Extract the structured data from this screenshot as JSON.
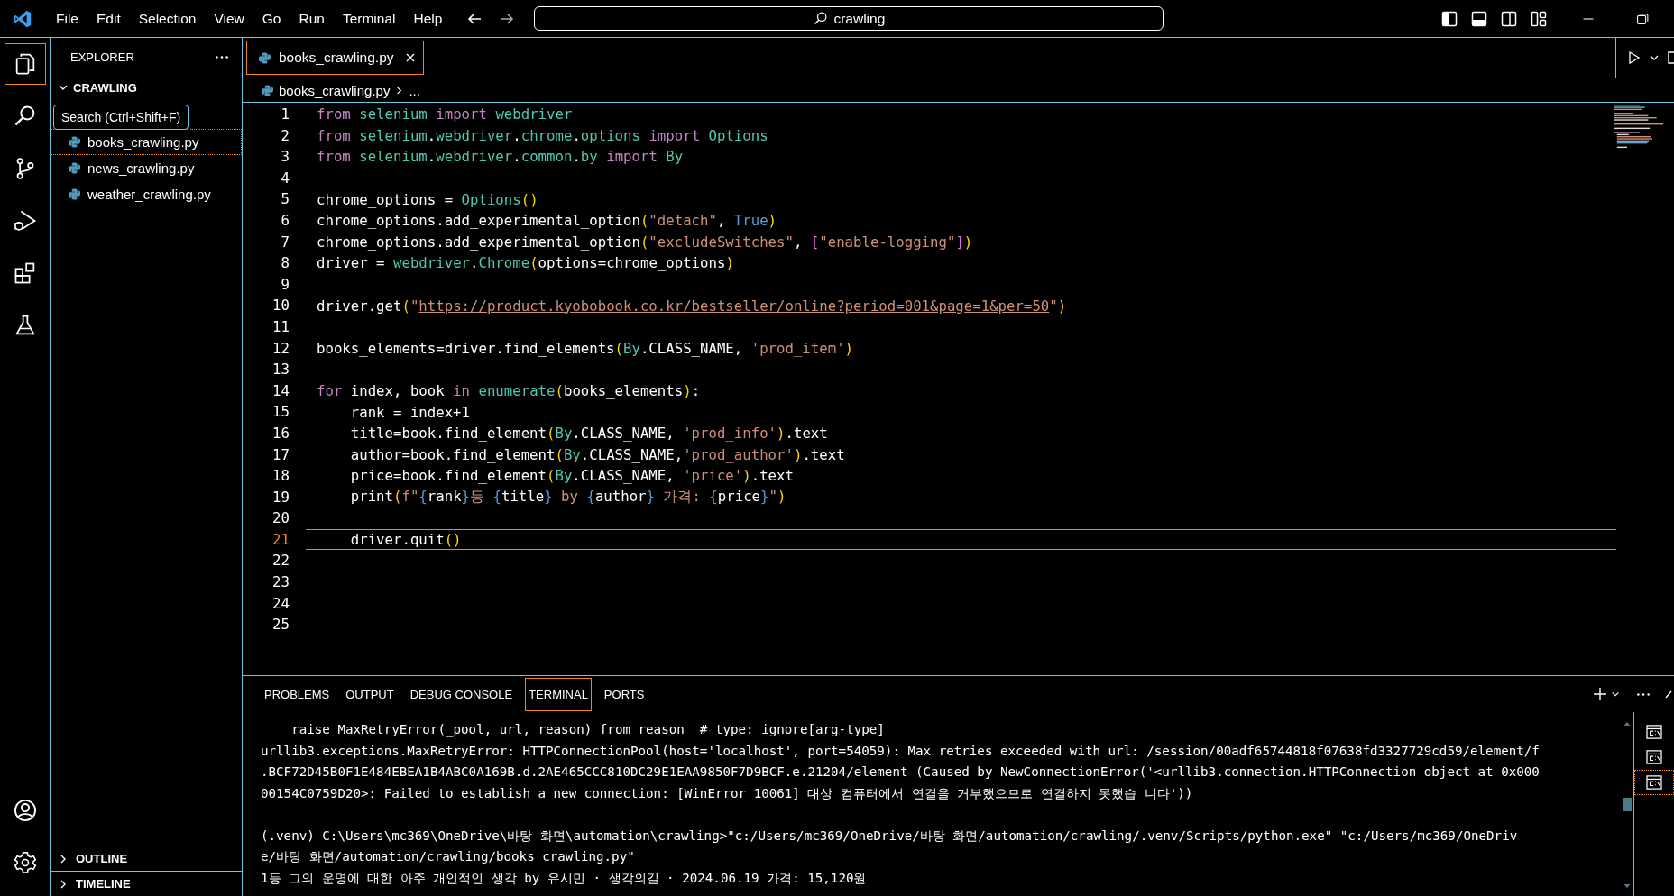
{
  "menu": [
    "File",
    "Edit",
    "Selection",
    "View",
    "Go",
    "Run",
    "Terminal",
    "Help"
  ],
  "command_center": {
    "value": "crawling"
  },
  "activity_bar": [
    {
      "kind": "files",
      "selected": true
    },
    {
      "kind": "search",
      "selected": false
    },
    {
      "kind": "source-control",
      "selected": false
    },
    {
      "kind": "run-debug",
      "selected": false
    },
    {
      "kind": "extensions",
      "selected": false
    },
    {
      "kind": "testing",
      "selected": false
    }
  ],
  "tooltip": "Search (Ctrl+Shift+F)",
  "sidebar": {
    "title": "EXPLORER",
    "folder": {
      "label": "CRAWLING",
      "expanded": true
    },
    "files": [
      {
        "name": "books_crawling.py",
        "selected": true
      },
      {
        "name": "news_crawling.py",
        "selected": false
      },
      {
        "name": "weather_crawling.py",
        "selected": false
      }
    ],
    "sections": [
      {
        "label": "OUTLINE",
        "expanded": false
      },
      {
        "label": "TIMELINE",
        "expanded": false
      }
    ]
  },
  "editor": {
    "tabs": [
      {
        "label": "books_crawling.py",
        "selected": true
      }
    ],
    "breadcrumb": [
      "books_crawling.py",
      "..."
    ],
    "lines": [
      {
        "number": "1",
        "current": false,
        "tokens": [
          {
            "kind": "kw",
            "text": "from "
          },
          {
            "kind": "mod",
            "text": "selenium "
          },
          {
            "kind": "kw",
            "text": "import "
          },
          {
            "kind": "mod",
            "text": "webdriver"
          }
        ]
      },
      {
        "number": "2",
        "current": false,
        "tokens": [
          {
            "kind": "kw",
            "text": "from "
          },
          {
            "kind": "mod",
            "text": "selenium"
          },
          {
            "kind": "plain",
            "text": "."
          },
          {
            "kind": "mod",
            "text": "webdriver"
          },
          {
            "kind": "plain",
            "text": "."
          },
          {
            "kind": "mod",
            "text": "chrome"
          },
          {
            "kind": "plain",
            "text": "."
          },
          {
            "kind": "mod",
            "text": "options "
          },
          {
            "kind": "kw",
            "text": "import "
          },
          {
            "kind": "mod",
            "text": "Options"
          }
        ]
      },
      {
        "number": "3",
        "current": false,
        "tokens": [
          {
            "kind": "kw",
            "text": "from "
          },
          {
            "kind": "mod",
            "text": "selenium"
          },
          {
            "kind": "plain",
            "text": "."
          },
          {
            "kind": "mod",
            "text": "webdriver"
          },
          {
            "kind": "plain",
            "text": "."
          },
          {
            "kind": "mod",
            "text": "common"
          },
          {
            "kind": "plain",
            "text": "."
          },
          {
            "kind": "mod",
            "text": "by "
          },
          {
            "kind": "kw",
            "text": "import "
          },
          {
            "kind": "mod",
            "text": "By"
          }
        ]
      },
      {
        "number": "4",
        "current": false
      },
      {
        "number": "5",
        "current": false,
        "tokens": [
          {
            "kind": "plain",
            "text": "chrome_options = "
          },
          {
            "kind": "mod",
            "text": "Options"
          },
          {
            "kind": "paren",
            "text": "()"
          }
        ]
      },
      {
        "number": "6",
        "current": false,
        "tokens": [
          {
            "kind": "plain",
            "text": "chrome_options.add_experimental_option"
          },
          {
            "kind": "paren",
            "text": "("
          },
          {
            "kind": "str",
            "text": "\"detach\""
          },
          {
            "kind": "plain",
            "text": ", "
          },
          {
            "kind": "const",
            "text": "True"
          },
          {
            "kind": "paren",
            "text": ")"
          }
        ]
      },
      {
        "number": "7",
        "current": false,
        "tokens": [
          {
            "kind": "plain",
            "text": "chrome_options.add_experimental_option"
          },
          {
            "kind": "paren",
            "text": "("
          },
          {
            "kind": "str",
            "text": "\"excludeSwitches\""
          },
          {
            "kind": "plain",
            "text": ", "
          },
          {
            "kind": "bracket",
            "text": "["
          },
          {
            "kind": "str",
            "text": "\"enable-logging\""
          },
          {
            "kind": "bracket",
            "text": "]"
          },
          {
            "kind": "paren",
            "text": ")"
          }
        ]
      },
      {
        "number": "8",
        "current": false,
        "tokens": [
          {
            "kind": "plain",
            "text": "driver = "
          },
          {
            "kind": "mod",
            "text": "webdriver"
          },
          {
            "kind": "plain",
            "text": "."
          },
          {
            "kind": "mod",
            "text": "Chrome"
          },
          {
            "kind": "paren",
            "text": "("
          },
          {
            "kind": "plain",
            "text": "options=chrome_options"
          },
          {
            "kind": "paren",
            "text": ")"
          }
        ]
      },
      {
        "number": "9",
        "current": false
      },
      {
        "number": "10",
        "current": false,
        "tokens": [
          {
            "kind": "plain",
            "text": "driver.get"
          },
          {
            "kind": "paren",
            "text": "("
          },
          {
            "kind": "str",
            "text": "\""
          },
          {
            "kind": "link",
            "text": "https://product.kyobobook.co.kr/bestseller/online?period=001&page=1&per=50"
          },
          {
            "kind": "str",
            "text": "\""
          },
          {
            "kind": "paren",
            "text": ")"
          }
        ]
      },
      {
        "number": "11",
        "current": false
      },
      {
        "number": "12",
        "current": false,
        "tokens": [
          {
            "kind": "plain",
            "text": "books_elements=driver.find_elements"
          },
          {
            "kind": "paren",
            "text": "("
          },
          {
            "kind": "mod",
            "text": "By"
          },
          {
            "kind": "plain",
            "text": ".CLASS_NAME, "
          },
          {
            "kind": "str",
            "text": "'prod_item'"
          },
          {
            "kind": "paren",
            "text": ")"
          }
        ]
      },
      {
        "number": "13",
        "current": false
      },
      {
        "number": "14",
        "current": false,
        "tokens": [
          {
            "kind": "kw",
            "text": "for "
          },
          {
            "kind": "plain",
            "text": "index, book "
          },
          {
            "kind": "kw",
            "text": "in "
          },
          {
            "kind": "mod",
            "text": "enumerate"
          },
          {
            "kind": "paren",
            "text": "("
          },
          {
            "kind": "plain",
            "text": "books_elements"
          },
          {
            "kind": "paren",
            "text": ")"
          },
          {
            "kind": "plain",
            "text": ":"
          }
        ]
      },
      {
        "number": "15",
        "current": false,
        "tokens": [
          {
            "kind": "plain",
            "text": "    rank = index+1"
          }
        ]
      },
      {
        "number": "16",
        "current": false,
        "tokens": [
          {
            "kind": "plain",
            "text": "    title=book.find_element"
          },
          {
            "kind": "paren",
            "text": "("
          },
          {
            "kind": "mod",
            "text": "By"
          },
          {
            "kind": "plain",
            "text": ".CLASS_NAME, "
          },
          {
            "kind": "str",
            "text": "'prod_info'"
          },
          {
            "kind": "paren",
            "text": ")"
          },
          {
            "kind": "plain",
            "text": ".text"
          }
        ]
      },
      {
        "number": "17",
        "current": false,
        "tokens": [
          {
            "kind": "plain",
            "text": "    author=book.find_element"
          },
          {
            "kind": "paren",
            "text": "("
          },
          {
            "kind": "mod",
            "text": "By"
          },
          {
            "kind": "plain",
            "text": ".CLASS_NAME,"
          },
          {
            "kind": "str",
            "text": "'prod_author'"
          },
          {
            "kind": "paren",
            "text": ")"
          },
          {
            "kind": "plain",
            "text": ".text"
          }
        ]
      },
      {
        "number": "18",
        "current": false,
        "tokens": [
          {
            "kind": "plain",
            "text": "    price=book.find_element"
          },
          {
            "kind": "paren",
            "text": "("
          },
          {
            "kind": "mod",
            "text": "By"
          },
          {
            "kind": "plain",
            "text": ".CLASS_NAME, "
          },
          {
            "kind": "str",
            "text": "'price'"
          },
          {
            "kind": "paren",
            "text": ")"
          },
          {
            "kind": "plain",
            "text": ".text"
          }
        ]
      },
      {
        "number": "19",
        "current": false,
        "tokens": [
          {
            "kind": "plain",
            "text": "    print"
          },
          {
            "kind": "paren",
            "text": "("
          },
          {
            "kind": "str",
            "text": "f\""
          },
          {
            "kind": "fbrace",
            "text": "{"
          },
          {
            "kind": "plain",
            "text": "rank"
          },
          {
            "kind": "fbrace",
            "text": "}"
          },
          {
            "kind": "str",
            "text": "등 "
          },
          {
            "kind": "fbrace",
            "text": "{"
          },
          {
            "kind": "plain",
            "text": "title"
          },
          {
            "kind": "fbrace",
            "text": "}"
          },
          {
            "kind": "str",
            "text": " by "
          },
          {
            "kind": "fbrace",
            "text": "{"
          },
          {
            "kind": "plain",
            "text": "author"
          },
          {
            "kind": "fbrace",
            "text": "}"
          },
          {
            "kind": "str",
            "text": " 가격: "
          },
          {
            "kind": "fbrace",
            "text": "{"
          },
          {
            "kind": "plain",
            "text": "price"
          },
          {
            "kind": "fbrace",
            "text": "}"
          },
          {
            "kind": "str",
            "text": "\""
          },
          {
            "kind": "paren",
            "text": ")"
          }
        ]
      },
      {
        "number": "20",
        "current": false
      },
      {
        "number": "21",
        "current": true,
        "tokens": [
          {
            "kind": "plain",
            "text": "    driver.quit"
          },
          {
            "kind": "paren",
            "text": "()"
          }
        ]
      },
      {
        "number": "22",
        "current": false
      },
      {
        "number": "23",
        "current": false
      },
      {
        "number": "24",
        "current": false
      },
      {
        "number": "25",
        "current": false
      }
    ]
  },
  "panel": {
    "tabs": [
      {
        "label": "PROBLEMS",
        "selected": false
      },
      {
        "label": "OUTPUT",
        "selected": false
      },
      {
        "label": "DEBUG CONSOLE",
        "selected": false
      },
      {
        "label": "TERMINAL",
        "selected": true
      },
      {
        "label": "PORTS",
        "selected": false
      }
    ],
    "terminal_blocks": [
      [
        "    raise MaxRetryError(_pool, url, reason) from reason  # type: ignore[arg-type]",
        "urllib3.exceptions.MaxRetryError: HTTPConnectionPool(host='localhost', port=54059): Max retries exceeded with url: /session/00adf65744818f07638fd3327729cd59/element/f",
        ".BCF72D45B0F1E484EBEA1B4ABC0A169B.d.2AE465CCC810DC29E1EAA9850F7D9BCF.e.21204/element (Caused by NewConnectionError('<urllib3.connection.HTTPConnection object at 0x000",
        "00154C0759D20>: Failed to establish a new connection: [WinError 10061] 대상 컴퓨터에서 연결을 거부했으므로 연결하지 못했습 니다'))"
      ],
      [
        "(.venv) C:\\Users\\mc369\\OneDrive\\바탕 화면\\automation\\crawling>\"c:/Users/mc369/OneDrive/바탕 화면/automation/crawling/.venv/Scripts/python.exe\" \"c:/Users/mc369/OneDriv",
        "e/바탕 화면/automation/crawling/books_crawling.py\"",
        "1등 그의 운명에 대한 아주 개인적인 생각 by 유시민 · 생각의길 · 2024.06.19 가격: 15,120원"
      ]
    ],
    "sessions": [
      {
        "selected": false
      },
      {
        "selected": false
      },
      {
        "selected": true
      }
    ]
  }
}
